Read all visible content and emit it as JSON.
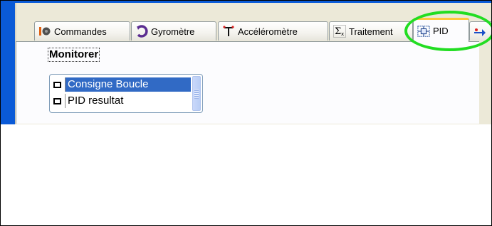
{
  "tabs": [
    {
      "label": "Commandes",
      "icon": "commands-icon"
    },
    {
      "label": "Gyromètre",
      "icon": "gyrometer-icon"
    },
    {
      "label": "Accéléromètre",
      "icon": "accelerometer-icon"
    },
    {
      "label": "Traitement",
      "icon": "sigma-icon"
    },
    {
      "label": "PID",
      "icon": "pid-icon",
      "active": true
    }
  ],
  "section": {
    "label": "Monitorer"
  },
  "monitor_list": {
    "items": [
      {
        "label": "Consigne Boucle",
        "checked": false,
        "selected": true
      },
      {
        "label": "PID resultat",
        "checked": false,
        "selected": false
      }
    ]
  },
  "colors": {
    "titlebar_blue": "#0a5ad7",
    "tab_active_accent": "#ffc83c",
    "selection": "#316ac5",
    "highlight_circle": "#22dd22"
  }
}
